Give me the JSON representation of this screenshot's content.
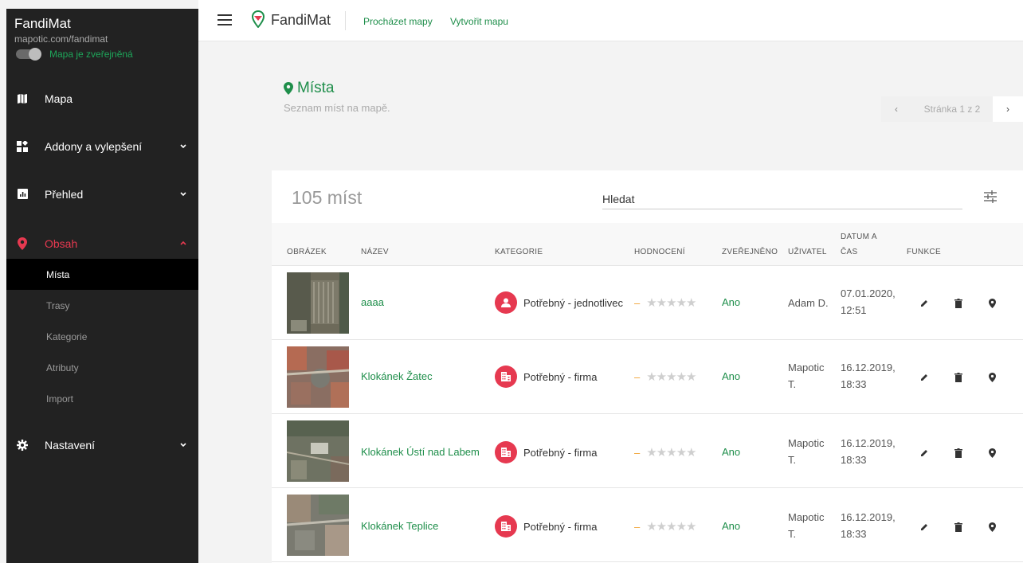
{
  "sidebar": {
    "title": "FandiMat",
    "url": "mapotic.com/fandimat",
    "publish_label": "Mapa je zveřejněná",
    "items": {
      "mapa": "Mapa",
      "addony": "Addony a vylepšení",
      "prehled": "Přehled",
      "obsah": "Obsah",
      "nastaveni": "Nastavení"
    },
    "subitems": [
      "Místa",
      "Trasy",
      "Kategorie",
      "Atributy",
      "Import"
    ]
  },
  "topbar": {
    "app_name": "FandiMat",
    "links": [
      "Procházet mapy",
      "Vytvořit mapu"
    ]
  },
  "page": {
    "title": "Místa",
    "subtitle": "Seznam míst na mapě.",
    "pager": {
      "prev": "‹",
      "text": "Stránka 1 z 2",
      "next": "›"
    }
  },
  "list": {
    "count": "105 míst",
    "search_placeholder": "Hledat",
    "headers": [
      "OBRÁZEK",
      "NÁZEV",
      "KATEGORIE",
      "HODNOCENÍ",
      "ZVEŘEJNĚNO",
      "UŽIVATEL",
      "DATUM A",
      "ČAS",
      "FUNKCE"
    ],
    "rows": [
      {
        "name": "aaaa",
        "category": "Potřebný - jednotlivec",
        "category_icon": "person-icon",
        "rating": "–",
        "stars": "★★★★★",
        "published": "Ano",
        "user1": "Adam D.",
        "user2": "",
        "date": "07.01.2020,",
        "time": "12:51"
      },
      {
        "name": "Klokánek Žatec",
        "category": "Potřebný - firma",
        "category_icon": "building-icon",
        "rating": "–",
        "stars": "★★★★★",
        "published": "Ano",
        "user1": "Mapotic",
        "user2": "T.",
        "date": "16.12.2019,",
        "time": "18:33"
      },
      {
        "name": "Klokánek Ústí nad Labem",
        "category": "Potřebný - firma",
        "category_icon": "building-icon",
        "rating": "–",
        "stars": "★★★★★",
        "published": "Ano",
        "user1": "Mapotic",
        "user2": "T.",
        "date": "16.12.2019,",
        "time": "18:33"
      },
      {
        "name": "Klokánek Teplice",
        "category": "Potřebný - firma",
        "category_icon": "building-icon",
        "rating": "–",
        "stars": "★★★★★",
        "published": "Ano",
        "user1": "Mapotic",
        "user2": "T.",
        "date": "16.12.2019,",
        "time": "18:33"
      }
    ]
  },
  "colors": {
    "accent": "#1e8e4a",
    "danger": "#e63950",
    "sidebar": "#222222"
  }
}
